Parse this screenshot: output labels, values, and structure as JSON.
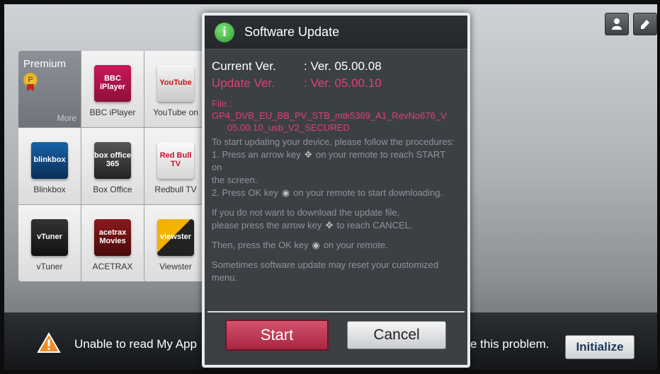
{
  "screen": {
    "top_icons": [
      {
        "icon": "user-icon"
      },
      {
        "icon": "edit-icon"
      }
    ]
  },
  "grid": {
    "premium": {
      "title": "Premium",
      "medal_letter": "P",
      "more_label": "More"
    },
    "apps": [
      {
        "label": "BBC iPlayer",
        "logo_text": "BBC iPlayer",
        "color": "#b3124a"
      },
      {
        "label": "YouTube on",
        "logo_text": "YouTube",
        "color": "#d8d8d8"
      },
      {
        "label": "Blinkbox",
        "logo_text": "blinkbox",
        "color": "#0b3f73"
      },
      {
        "label": "Box Office",
        "logo_text": "box office 365",
        "color": "#3a3a3a"
      },
      {
        "label": "Redbull TV",
        "logo_text": "Red Bull TV",
        "color": "#e8e8e8"
      },
      {
        "label": "vTuner",
        "logo_text": "vTuner",
        "color": "#1c1c1c"
      },
      {
        "label": "ACETRAX",
        "logo_text": "acetrax Movies",
        "color": "#6b1212"
      },
      {
        "label": "Viewster",
        "logo_text": "viewster",
        "color": "#222"
      }
    ]
  },
  "notice": {
    "text_left": "Unable to read My App",
    "text_right": "e this problem.",
    "initialize_label": "Initialize"
  },
  "dialog": {
    "title": "Software Update",
    "current_label": "Current Ver.",
    "current_value": ": Ver. 05.00.08",
    "update_label": "Update Ver.",
    "update_value": ": Ver. 05.00.10",
    "file_line1": "File : GP4_DVB_EU_BB_PV_STB_mtk5369_A1_RevNo676_V",
    "file_line2": "05.00.10_usb_V2_SECURED",
    "instructions": {
      "intro": "To start updating your device, please follow the procedures:",
      "step1a": "1. Press an arrow key",
      "step1b": "on your remote to reach START on",
      "step1c": "the screen.",
      "step2a": "2. Press OK key",
      "step2b": "on your remote to start downloading.",
      "cancel1": "If you do not want to download the update file,",
      "cancel2a": "please press the arrow key",
      "cancel2b": "to reach CANCEL.",
      "ok_a": "Then, press the OK key",
      "ok_b": "on your remote.",
      "reset": "Sometimes software update may reset your customized menu."
    },
    "start_label": "Start",
    "cancel_label": "Cancel"
  },
  "colors": {
    "accent_pink": "#e0406e",
    "start_button": "#b83550",
    "dialog_bg": "#3b4045"
  }
}
